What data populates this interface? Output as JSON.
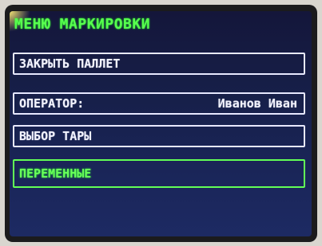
{
  "menu": {
    "title": "МЕНЮ МАРКИРОВКИ",
    "items": [
      {
        "label": "ЗАКРЫТЬ ПАЛЛЕТ",
        "value": "",
        "selected": false
      },
      {
        "label": "ОПЕРАТОР:",
        "value": "Иванов Иван",
        "selected": false
      },
      {
        "label": "ВЫБОР ТАРЫ",
        "value": "",
        "selected": false
      },
      {
        "label": "ПЕРЕМЕННЫЕ",
        "value": "",
        "selected": true
      }
    ]
  },
  "colors": {
    "title_green": "#58ff4f",
    "selected_border": "#62ff56",
    "item_border": "#e7e8ff",
    "screen_bg": "#17204a"
  }
}
